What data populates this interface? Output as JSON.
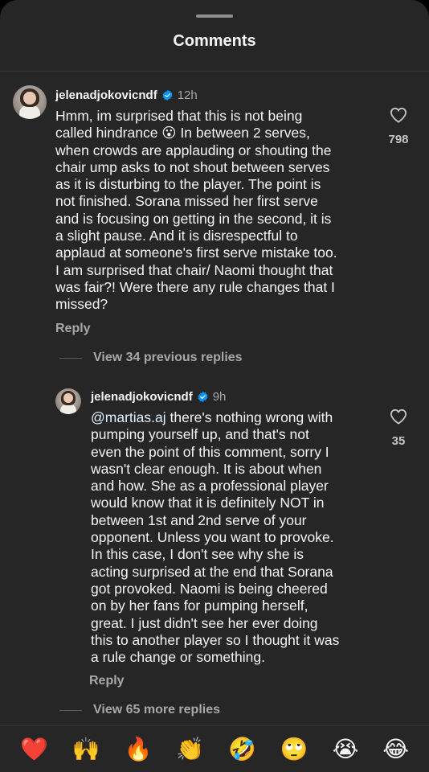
{
  "header": {
    "title": "Comments"
  },
  "comment": {
    "username": "jelenadjokovicndf",
    "time": "12h",
    "text": "Hmm, im surprised that this is not being\ncalled hindrance 😮 In between 2 serves,\nwhen crowds are applauding or shouting the\nchair ump asks to not shout between serves\nas it is disturbing to the player. The point is\nnot finished. Sorana missed her first serve\nand is focusing on getting in the second, it is\na slight pause. And it is disrespectful to\napplaud at someone's first serve mistake too.\nI am surprised that chair/ Naomi thought that\nwas fair?! Were there any rule changes that I\nmissed?",
    "likes": "798",
    "reply_label": "Reply",
    "view_replies": "View 34 previous replies"
  },
  "reply": {
    "username": "jelenadjokovicndf",
    "time": "9h",
    "mention": "@martias.aj",
    "text": " there's nothing wrong with\npumping yourself up, and that's not\neven the point of this comment, sorry I\nwasn't clear enough. It is about when\nand how. She as a professional player\nwould know that it is definitely NOT in\nbetween 1st and 2nd serve of your\nopponent. Unless you want to provoke.\nIn this case, I don't see why she is\nacting surprised at the end that Sorana\ngot provoked. Naomi is being cheered\non by her fans for pumping herself,\ngreat. I just didn't see her ever doing\nthis to another player so I thought it was\na rule change or something.",
    "likes": "35",
    "reply_label": "Reply",
    "view_more": "View 65 more replies"
  },
  "emoji_bar": [
    {
      "name": "red-heart",
      "glyph": "❤️"
    },
    {
      "name": "raising-hands",
      "glyph": "🙌"
    },
    {
      "name": "fire",
      "glyph": "🔥"
    },
    {
      "name": "clapping-hands",
      "glyph": "👏"
    },
    {
      "name": "rolling-on-floor-laughing",
      "glyph": "🤣"
    },
    {
      "name": "face-with-rolling-eyes",
      "glyph": "🙄"
    },
    {
      "name": "loudly-crying-face",
      "glyph": "😭"
    },
    {
      "name": "face-with-tears-of-joy",
      "glyph": "😂"
    }
  ],
  "colors": {
    "background": "#262626",
    "text": "#f5f5f5",
    "secondary": "#a8a8a8",
    "verified": "#0095f6",
    "mention": "#e0f1ff"
  }
}
